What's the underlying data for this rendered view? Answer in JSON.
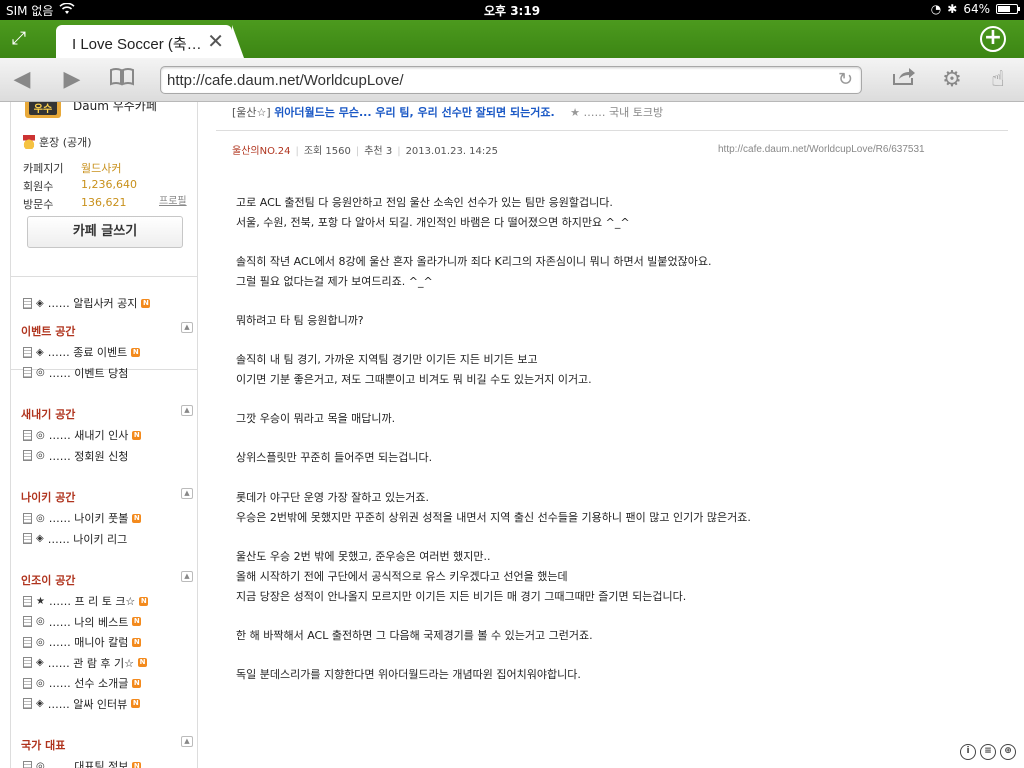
{
  "status_bar": {
    "carrier": "SIM 없음",
    "time": "오후 3:19",
    "battery": "64%",
    "battery_level": 0.64
  },
  "tab": {
    "title": "I Love Soccer (축…",
    "close_icon": "close-icon",
    "fullscreen_icon": "expand-icon",
    "add_icon": "plus-circle-icon"
  },
  "toolbar": {
    "url": "http://cafe.daum.net/WorldcupLove/",
    "icons": [
      "back-arrow-icon",
      "forward-arrow-icon",
      "bookmarks-book-icon",
      "reload-icon",
      "share-icon",
      "gear-icon",
      "hand-pointer-icon"
    ]
  },
  "sidebar": {
    "cafe_grade": "Daum 우수카페",
    "badge": "우수",
    "manager": "훈장 (공개)",
    "info": [
      {
        "label": "카페지기",
        "value": "월드사커"
      },
      {
        "label": "회원수",
        "value": "1,236,640"
      },
      {
        "label": "방문수",
        "value": "136,621"
      }
    ],
    "profile_link": "프로필",
    "write_button": "카페 글쓰기",
    "menu": {
      "top_item": {
        "symbol": "◈",
        "label": "…… 알립사커 공지"
      },
      "sections": [
        {
          "title": "이벤트 공간",
          "items": [
            {
              "symbol": "◈",
              "label": "…… 종료 이벤트",
              "new": true
            },
            {
              "symbol": "◎",
              "label": "…… 이벤트 당첨",
              "new": false
            }
          ]
        },
        {
          "title": "새내기 공간",
          "items": [
            {
              "symbol": "◎",
              "label": "…… 새내기 인사",
              "new": true
            },
            {
              "symbol": "◎",
              "label": "…… 정회원 신청",
              "new": false
            }
          ]
        },
        {
          "title": "나이키 공간",
          "items": [
            {
              "symbol": "◎",
              "label": "…… 나이키 풋볼",
              "new": true
            },
            {
              "symbol": "◈",
              "label": "…… 나이키 리그",
              "new": false
            }
          ]
        },
        {
          "title": "인조이 공간",
          "items": [
            {
              "symbol": "★",
              "label": "…… 프 리 토 크☆",
              "new": true
            },
            {
              "symbol": "◎",
              "label": "…… 나의 베스트",
              "new": true
            },
            {
              "symbol": "◎",
              "label": "…… 매니아 칼럼",
              "new": true
            },
            {
              "symbol": "◈",
              "label": "…… 관 람 후 기☆",
              "new": true
            },
            {
              "symbol": "◎",
              "label": "…… 선수 소개글",
              "new": true
            },
            {
              "symbol": "◈",
              "label": "…… 알싸 인터뷰",
              "new": true
            }
          ]
        },
        {
          "title": "국가 대표",
          "items": [
            {
              "symbol": "◎",
              "label": "…… 대표팀 정보",
              "new": true
            }
          ]
        }
      ],
      "new_badge": "N",
      "collapse_glyph": "▲"
    }
  },
  "post": {
    "category": "[울산☆]",
    "title_link": "위아더월드는 무슨... 우리 팀, 우리 선수만 잘되면 되는거죠.",
    "board_sep": "★",
    "board": "…… 국내 토크방",
    "author": "울산의NO.24",
    "views": "조회 1560",
    "recommend": "추천 3",
    "date": "2013.01.23. 14:25",
    "permalink": "http://cafe.daum.net/WorldcupLove/R6/637531",
    "body": [
      "고로 ACL 출전팀 다 응원안하고 전임 울산 소속인 선수가 있는 팀만 응원할겁니다.",
      "서울, 수원, 전북, 포항 다 알아서 되길. 개인적인 바램은 다 떨어졌으면 하지만요 ^_^",
      "솔직히 작년 ACL에서 8강에 울산 혼자 올라가니까 죄다 K리그의 자존심이니 뭐니 하면서 빌붙었잖아요.",
      "그럴 필요 없다는걸 제가 보여드리죠. ^_^",
      "뭐하려고 타 팀 응원합니까?",
      "솔직히 내 팀 경기, 가까운 지역팀 경기만 이기든 지든 비기든 보고",
      "이기면 기분 좋은거고, 져도 그때뿐이고 비겨도 뭐 비길 수도 있는거지 이거고.",
      "그깟 우승이 뭐라고 목을 매답니까.",
      "상위스플릿만 꾸준히 들어주면 되는겁니다.",
      "롯데가 야구단 운영 가장 잘하고 있는거죠.",
      "우승은 2번밖에 못했지만 꾸준히 상위권 성적을 내면서 지역 출신 선수들을 기용하니 팬이 많고 인기가 많은거죠.",
      "울산도 우승 2번 밖에 못했고, 준우승은 여러번 했지만..",
      "올해 시작하기 전에 구단에서 공식적으로 유스 키우겠다고 선언을 했는데",
      "지금 당장은 성적이 안나올지 모르지만 이기든 지든 비기든 매 경기 그때그때만 즐기면 되는겁니다.",
      "한 해 바짝해서 ACL 출전하면 그 다음해 국제경기를 볼 수 있는거고 그런거죠.",
      "독일 분데스리가를 지향한다면 위아더월드라는 개념따윈 집어치워야합니다."
    ]
  },
  "footer_icons": [
    "i",
    "≡",
    "⊕"
  ]
}
